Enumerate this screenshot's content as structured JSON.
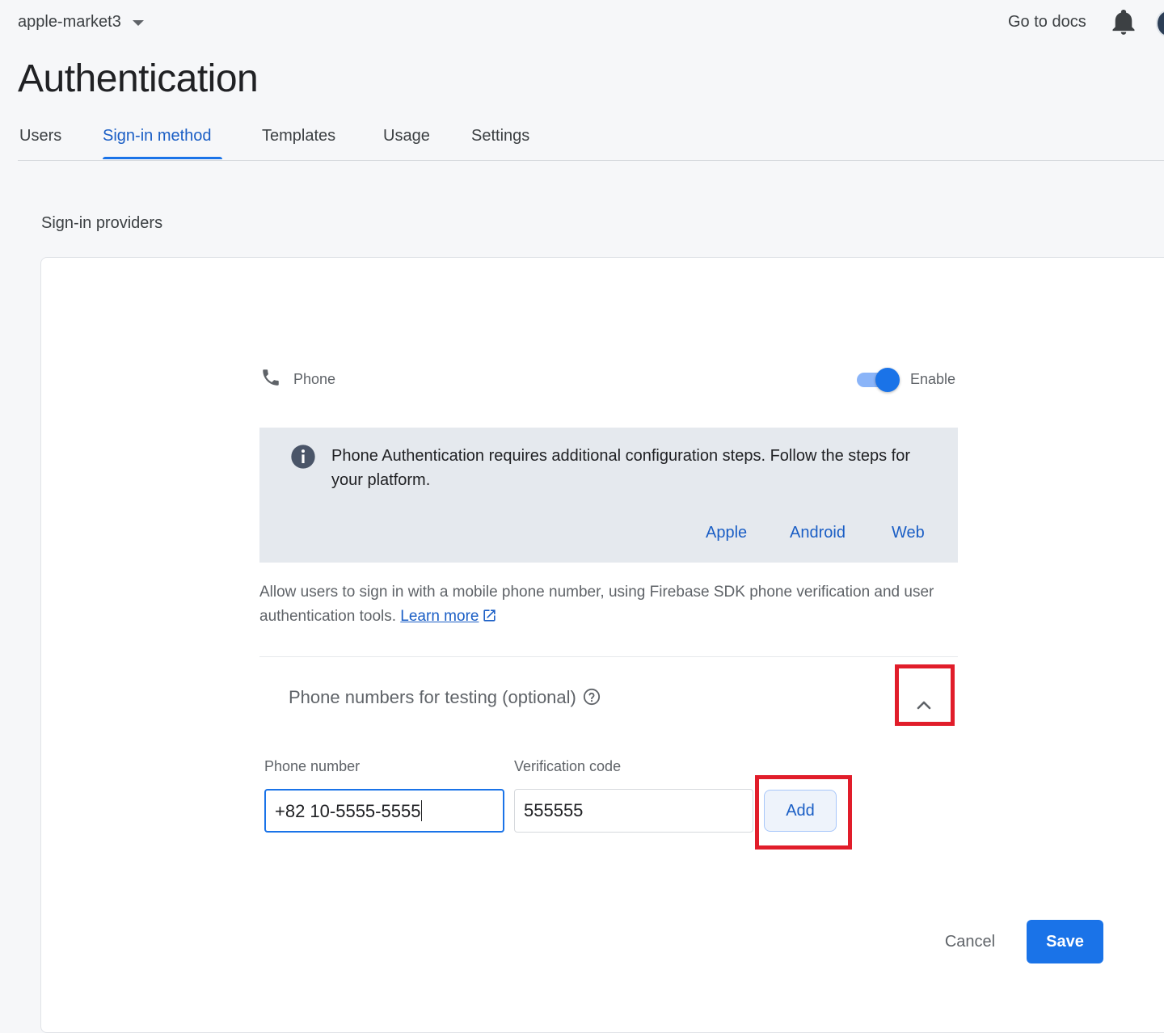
{
  "topbar": {
    "project_name": "apple-market3",
    "docs_link": "Go to docs"
  },
  "page": {
    "title": "Authentication"
  },
  "tabs": [
    {
      "label": "Users",
      "active": false
    },
    {
      "label": "Sign-in method",
      "active": true
    },
    {
      "label": "Templates",
      "active": false
    },
    {
      "label": "Usage",
      "active": false
    },
    {
      "label": "Settings",
      "active": false
    }
  ],
  "section": {
    "label": "Sign-in providers"
  },
  "provider": {
    "name": "Phone",
    "enable_label": "Enable",
    "enabled": true
  },
  "info": {
    "text": "Phone Authentication requires additional configuration steps. Follow the steps for your platform.",
    "links": [
      "Apple",
      "Android",
      "Web"
    ]
  },
  "description": {
    "text": "Allow users to sign in with a mobile phone number, using Firebase SDK phone verification and user authentication tools.",
    "link": "Learn more"
  },
  "testing": {
    "title": "Phone numbers for testing (optional)",
    "phone_label": "Phone number",
    "phone_value": "+82 10-5555-5555",
    "code_label": "Verification code",
    "code_value": "555555",
    "add_label": "Add"
  },
  "actions": {
    "cancel": "Cancel",
    "save": "Save"
  },
  "colors": {
    "accent": "#1a73e8",
    "highlight": "#e11d2a",
    "info_bg": "#e5e9ee"
  }
}
